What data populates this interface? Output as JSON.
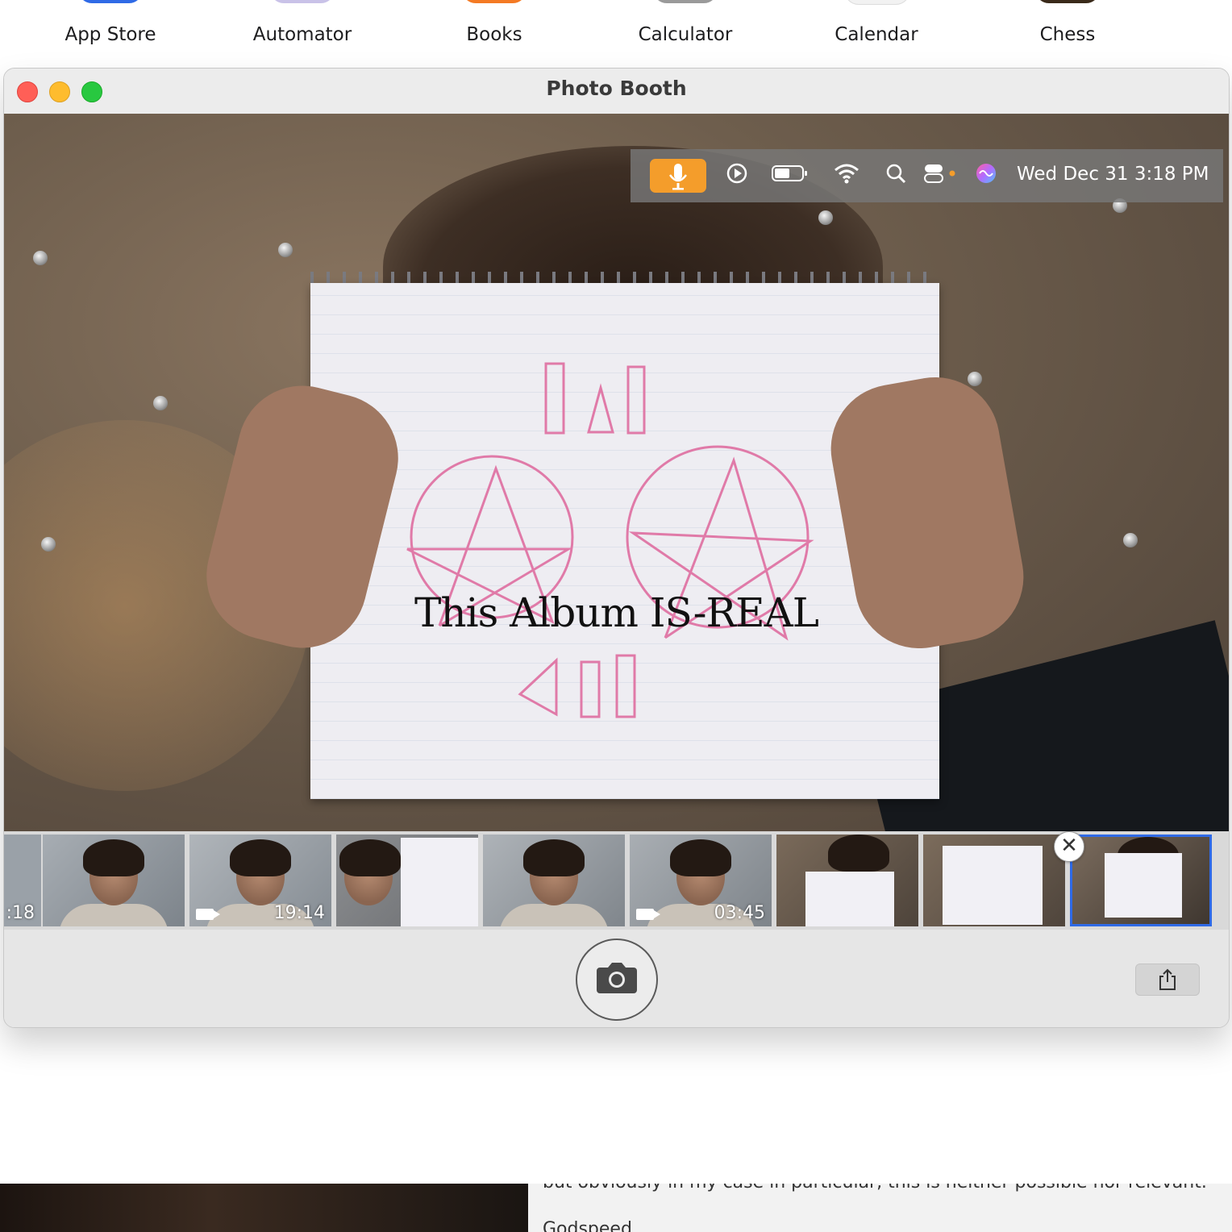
{
  "apps": [
    {
      "label": "App Store",
      "color": "#2f6ae6"
    },
    {
      "label": "Automator",
      "color": "#c9c2e8"
    },
    {
      "label": "Books",
      "color": "#f47a24"
    },
    {
      "label": "Calculator",
      "color": "#9a9a9a"
    },
    {
      "label": "Calendar",
      "color": "#f2f2f2"
    },
    {
      "label": "Chess",
      "color": "#3a2a1a"
    }
  ],
  "window": {
    "title": "Photo Booth"
  },
  "menubar": {
    "mic_icon": "microphone-icon",
    "icons": [
      "play-circle-icon",
      "battery-icon",
      "wifi-icon",
      "search-icon",
      "control-center-icon",
      "siri-icon"
    ],
    "datetime": "Wed Dec 31  3:18 PM",
    "accent": "#f49d2b"
  },
  "preview": {
    "caption": "This Album IS-REAL"
  },
  "thumbnails": [
    {
      "kind": "video",
      "duration": ":18"
    },
    {
      "kind": "photo",
      "duration": ""
    },
    {
      "kind": "video",
      "duration": "19:14"
    },
    {
      "kind": "photo",
      "duration": ""
    },
    {
      "kind": "photo",
      "duration": ""
    },
    {
      "kind": "video",
      "duration": "03:45"
    },
    {
      "kind": "photo",
      "duration": ""
    },
    {
      "kind": "photo",
      "duration": ""
    },
    {
      "kind": "photo",
      "duration": "",
      "selected": true
    }
  ],
  "toolbar": {
    "shutter_icon": "camera-icon",
    "share_icon": "share-icon"
  },
  "background_doc": {
    "line1": "but obviously in my case in particular, this is neither possible nor relevant.",
    "line2": "Godspeed"
  }
}
